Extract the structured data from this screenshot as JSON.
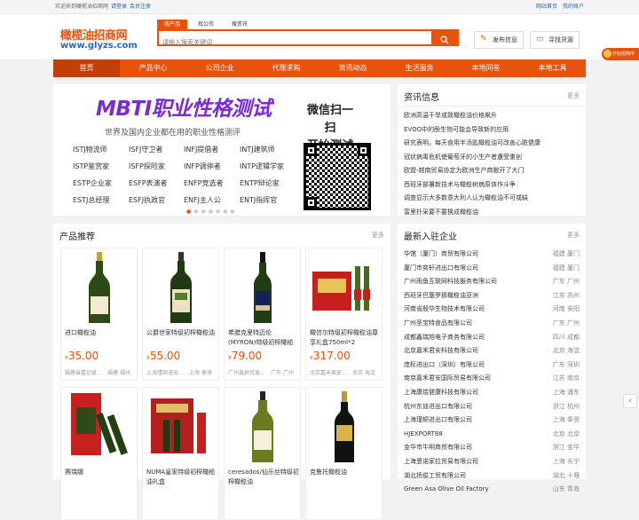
{
  "topbar": {
    "welcome": "欢迎来到橄榄油招商网",
    "login": "请登录",
    "register": "会员注册",
    "home": "网站首页",
    "account": "我的账户"
  },
  "logo": {
    "name": "橄榄油招商网",
    "domain": "www.glyzs.com"
  },
  "search": {
    "tabs": [
      "找产品",
      "找公司",
      "搜资讯"
    ],
    "active_tab": 0,
    "placeholder": "请输入搜索关键词"
  },
  "header_buttons": {
    "post": "发布信息",
    "find": "寻找货源"
  },
  "nav": [
    "首页",
    "产品中心",
    "公司企业",
    "代理求购",
    "资讯动态",
    "生活服务",
    "本地问答",
    "本地工具"
  ],
  "banner": {
    "title": "MBTI职业性格测试",
    "subtitle": "世界及国内企业都在用的职业性格测评",
    "types": [
      "ISTJ物流师",
      "ISFJ守卫者",
      "INFJ提倡者",
      "INTJ建筑师",
      "ISTP鉴赏家",
      "ISFP探险家",
      "INFP调停者",
      "INTP逻辑学家",
      "ESTP企业家",
      "ESFP表演者",
      "ENFP竞选者",
      "ENTP辩论家",
      "ESTJ总经理",
      "ESFJ执政官",
      "ENFJ主人公",
      "ENTJ指挥官"
    ],
    "qr_text1": "微信扫一扫",
    "qr_text2": "开始测试"
  },
  "news": {
    "title": "资讯信息",
    "more": "更多",
    "items": [
      "欧洲高温干旱或致橄榄油价格飙升",
      "EVOO中的酚生物可能会导致新的应用",
      "研究表明，每天食用半汤匙橄榄油可改善心脏健康",
      "冠状病毒危机使葡萄牙的小生产者遭受重创",
      "欧盟-越南贸易协定为欧洲生产商敞开了大门",
      "西班牙部署新技术与橄榄树病原体作斗争",
      "调查显示大多数意大利人认为橄榄油不可或缺",
      "富里扑采要不要换成橄榄油"
    ]
  },
  "products": {
    "title": "产品推荐",
    "more": "更多",
    "items": [
      {
        "name": "进口橄榄油",
        "price": "35.00",
        "company": "福建省嘉记食…",
        "place": "福建 福州"
      },
      {
        "name": "公爵世家特级初榨橄榄油",
        "price": "55.00",
        "company": "上海瑾顿进出…",
        "place": "上海 奉贤"
      },
      {
        "name": "希腊克里特迈伦(MYRON)特级初榨橄榄",
        "price": "79.00",
        "company": "广州鑫纳贸易…",
        "place": "广东 广州"
      },
      {
        "name": "橄信尔特级初榨橄榄油尊享礼盒750ml*2",
        "price": "317.00",
        "company": "北京嘉禾君安…",
        "place": "北京 海淀"
      },
      {
        "name": "赛瑞娜",
        "price": "",
        "company": "",
        "place": ""
      },
      {
        "name": "NUMA皇家特级初榨橄榄油礼盒",
        "price": "",
        "company": "",
        "place": ""
      },
      {
        "name": "ceresados/仙乐丝特级初榨橄榄油",
        "price": "",
        "company": "",
        "place": ""
      },
      {
        "name": "克鲁托橄榄油",
        "price": "",
        "company": "",
        "place": ""
      }
    ]
  },
  "companies": {
    "title": "最新入驻企业",
    "more": "更多",
    "items": [
      {
        "name": "华馆（厦门）商贸有限公司",
        "area": "福建 厦门"
      },
      {
        "name": "厦门市奕轩进出口有限公司",
        "area": "福建 厦门"
      },
      {
        "name": "广州雨鱼互联网科技服务有限公司",
        "area": "广东 广州"
      },
      {
        "name": "西班牙巴塞罗那橄榄油亚洲",
        "area": "江苏 苏州"
      },
      {
        "name": "河南省殷华生物技术有限公司",
        "area": "河南 安阳"
      },
      {
        "name": "广州圣宝特食品有限公司",
        "area": "广东 广州"
      },
      {
        "name": "成都鑫瑞旭电子商务有限公司",
        "area": "四川 成都"
      },
      {
        "name": "北京嘉禾君安科技有限公司",
        "area": "北京 海淀"
      },
      {
        "name": "庞标进出口（深圳）有限公司",
        "area": "广东 深圳"
      },
      {
        "name": "南京嘉禾君安国际贸易有限公司",
        "area": "江苏 南京"
      },
      {
        "name": "上海康煜健康科技有限公司",
        "area": "上海 浦东"
      },
      {
        "name": "杭州东迪进出口有限公司",
        "area": "浙江 杭州"
      },
      {
        "name": "上海瑾顿进出口有限公司",
        "area": "上海 奉贤"
      },
      {
        "name": "HJEXPORT88",
        "area": "北京 北京"
      },
      {
        "name": "金华市牛明商贸有限公司",
        "area": "浙江 金华"
      },
      {
        "name": "上海恩诺家拉贸易有限公司",
        "area": "上海 长宁"
      },
      {
        "name": "湖北扬俊工贸有限公司",
        "area": "湖北 十堰"
      },
      {
        "name": "Green Asa Olive Oil Factory",
        "area": "山东 青岛"
      }
    ]
  },
  "float": {
    "label": "开始招商中"
  }
}
